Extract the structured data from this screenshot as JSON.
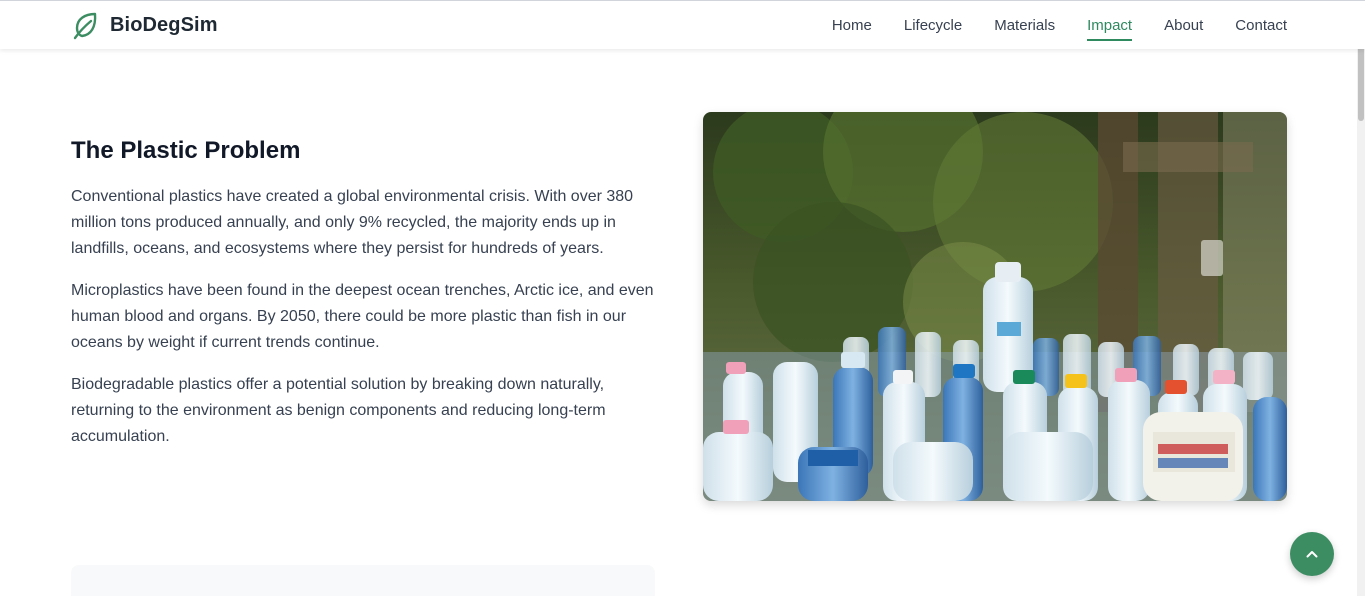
{
  "brand": {
    "name": "BioDegSim",
    "logo_icon": "leaf-icon",
    "accent": "#2f8a60"
  },
  "nav": {
    "items": [
      {
        "label": "Home",
        "active": false
      },
      {
        "label": "Lifecycle",
        "active": false
      },
      {
        "label": "Materials",
        "active": false
      },
      {
        "label": "Impact",
        "active": true
      },
      {
        "label": "About",
        "active": false
      },
      {
        "label": "Contact",
        "active": false
      }
    ]
  },
  "section": {
    "title": "The Plastic Problem",
    "paragraphs": [
      "Conventional plastics have created a global environmental crisis. With over 380 million tons produced annually, and only 9% recycled, the majority ends up in landfills, oceans, and ecosystems where they persist for hundreds of years.",
      "Microplastics have been found in the deepest ocean trenches, Arctic ice, and even human blood and organs. By 2050, there could be more plastic than fish in our oceans by weight if current trends continue.",
      "Biodegradable plastics offer a potential solution by breaking down naturally, returning to the environment as benign components and reducing long-term accumulation."
    ],
    "image_subject": "plastic-bottles-photo"
  },
  "back_to_top": {
    "icon": "chevron-up-icon",
    "color": "#3d8d63"
  }
}
